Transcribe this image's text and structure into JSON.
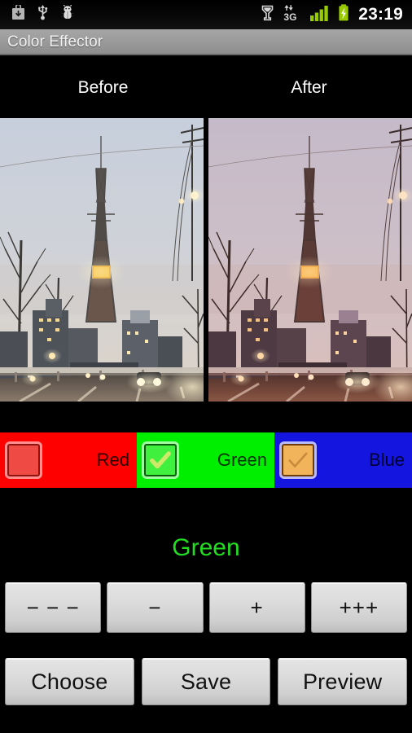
{
  "statusbar": {
    "time": "23:19",
    "left_icons": [
      {
        "name": "download-icon",
        "label": "Download"
      },
      {
        "name": "usb-icon",
        "label": "USB connected"
      },
      {
        "name": "android-debug-icon",
        "label": "USB debugging"
      }
    ],
    "right_icons": [
      {
        "name": "alarm-icon",
        "label": "Alarm set"
      },
      {
        "name": "network-3g-icon",
        "label": "3G"
      },
      {
        "name": "signal-bars-icon",
        "label": "Signal strength"
      },
      {
        "name": "battery-charging-icon",
        "label": "Battery charging"
      }
    ],
    "accent_green": "#99cc00"
  },
  "titlebar": {
    "title": "Color Effector"
  },
  "preview": {
    "before_label": "Before",
    "after_label": "After"
  },
  "channels": [
    {
      "key": "red",
      "label": "Red",
      "color": "#ff0000",
      "text_color": "#2a0000",
      "checked": false,
      "box_state": "off"
    },
    {
      "key": "green",
      "label": "Green",
      "color": "#00ee00",
      "text_color": "#003300",
      "checked": true,
      "box_state": "on-green"
    },
    {
      "key": "blue",
      "label": "Blue",
      "color": "#1515e0",
      "text_color": "#000033",
      "checked": true,
      "box_state": "on-amber"
    }
  ],
  "selected_channel": {
    "label": "Green",
    "color": "#22dd22"
  },
  "adjust_buttons": [
    {
      "name": "decrease-large-button",
      "label": "− − −"
    },
    {
      "name": "decrease-small-button",
      "label": "−"
    },
    {
      "name": "increase-small-button",
      "label": "+"
    },
    {
      "name": "increase-large-button",
      "label": "+++"
    }
  ],
  "action_buttons": [
    {
      "name": "choose-button",
      "label": "Choose"
    },
    {
      "name": "save-button",
      "label": "Save"
    },
    {
      "name": "preview-button",
      "label": "Preview"
    }
  ]
}
